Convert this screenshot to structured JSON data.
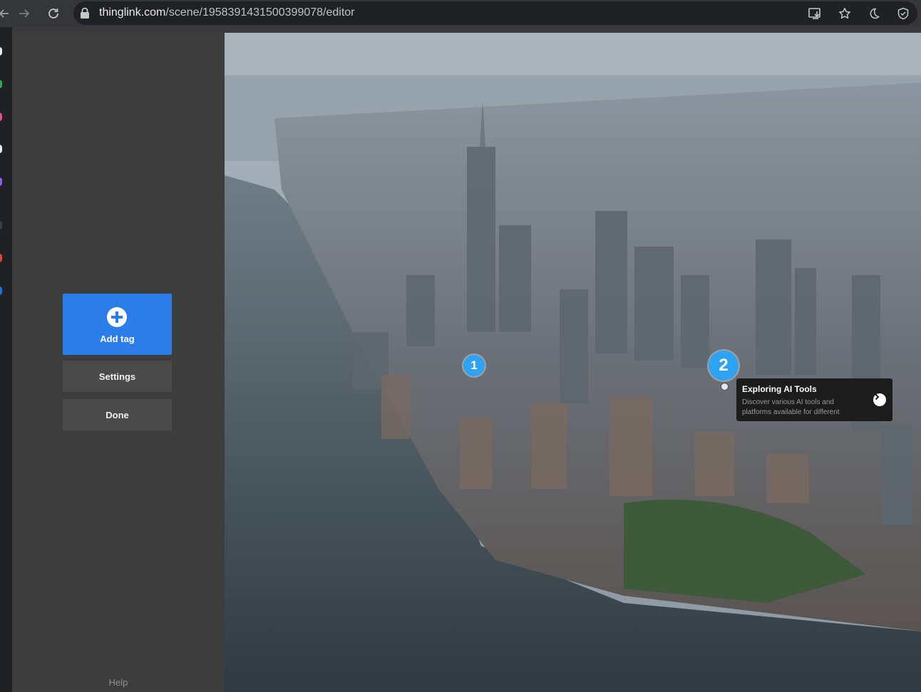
{
  "browser": {
    "url_host": "thinglink.com",
    "url_path": "/scene/1958391431500399078/editor"
  },
  "sidebar": {
    "add_tag_label": "Add tag",
    "settings_label": "Settings",
    "done_label": "Done",
    "help_label": "Help"
  },
  "scene": {
    "hotspots": [
      {
        "number": "1"
      },
      {
        "number": "2"
      }
    ],
    "tooltip": {
      "title": "Exploring AI Tools",
      "description": "Discover various AI tools and platforms available for different"
    }
  },
  "colors": {
    "accent": "#2b7de9",
    "hotspot": "#2ea3f2",
    "sidebar_bg": "#3d3d3d"
  },
  "icons": [
    "back-arrow-icon",
    "forward-arrow-icon",
    "reload-icon",
    "lock-icon",
    "install-icon",
    "star-icon",
    "dark-mode-icon",
    "shield-icon",
    "plus-circle-icon",
    "chevron-right-icon"
  ]
}
